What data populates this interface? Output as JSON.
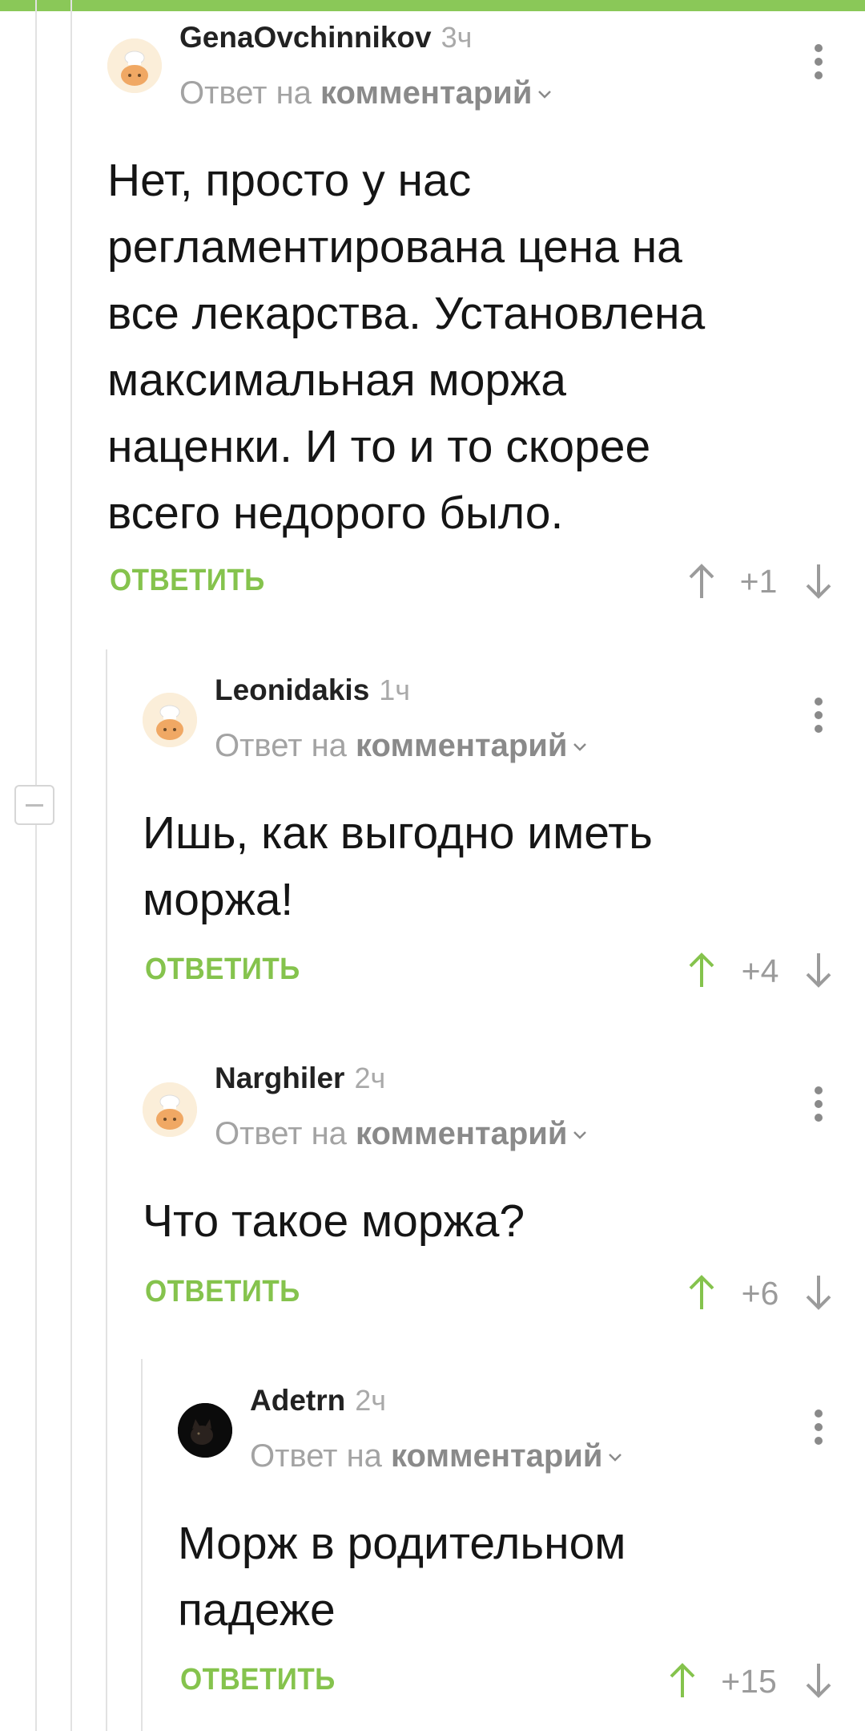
{
  "colors": {
    "accent": "#85c34d",
    "muted": "#a3a3a3",
    "topbar": "#8ac858"
  },
  "comments": [
    {
      "author": "GenaOvchinnikov",
      "time": "3ч",
      "reply_prefix": "Ответ на",
      "reply_target": "комментарий",
      "text": "Нет, просто у нас\nрегламентирована цена на\nвсе лекарства. Установлена\nмаксимальная моржа\nнаценки. И то и то скорее\nвсего недорого было.",
      "reply_label": "ОТВЕТИТЬ",
      "rating": "+1",
      "avatar_icon": "chef-cat-avatar"
    },
    {
      "author": "Leonidakis",
      "time": "1ч",
      "reply_prefix": "Ответ на",
      "reply_target": "комментарий",
      "text": "Ишь, как выгодно иметь\nморжа!",
      "reply_label": "ОТВЕТИТЬ",
      "rating": "+4",
      "avatar_icon": "chef-cat-avatar"
    },
    {
      "author": "Narghiler",
      "time": "2ч",
      "reply_prefix": "Ответ на",
      "reply_target": "комментарий",
      "text": "Что такое моржа?",
      "reply_label": "ОТВЕТИТЬ",
      "rating": "+6",
      "avatar_icon": "chef-cat-avatar"
    },
    {
      "author": "Adetrn",
      "time": "2ч",
      "reply_prefix": "Ответ на",
      "reply_target": "комментарий",
      "text": "Морж в родительном\nпадеже",
      "reply_label": "ОТВЕТИТЬ",
      "rating": "+15",
      "avatar_icon": "dark-cat-avatar"
    }
  ]
}
